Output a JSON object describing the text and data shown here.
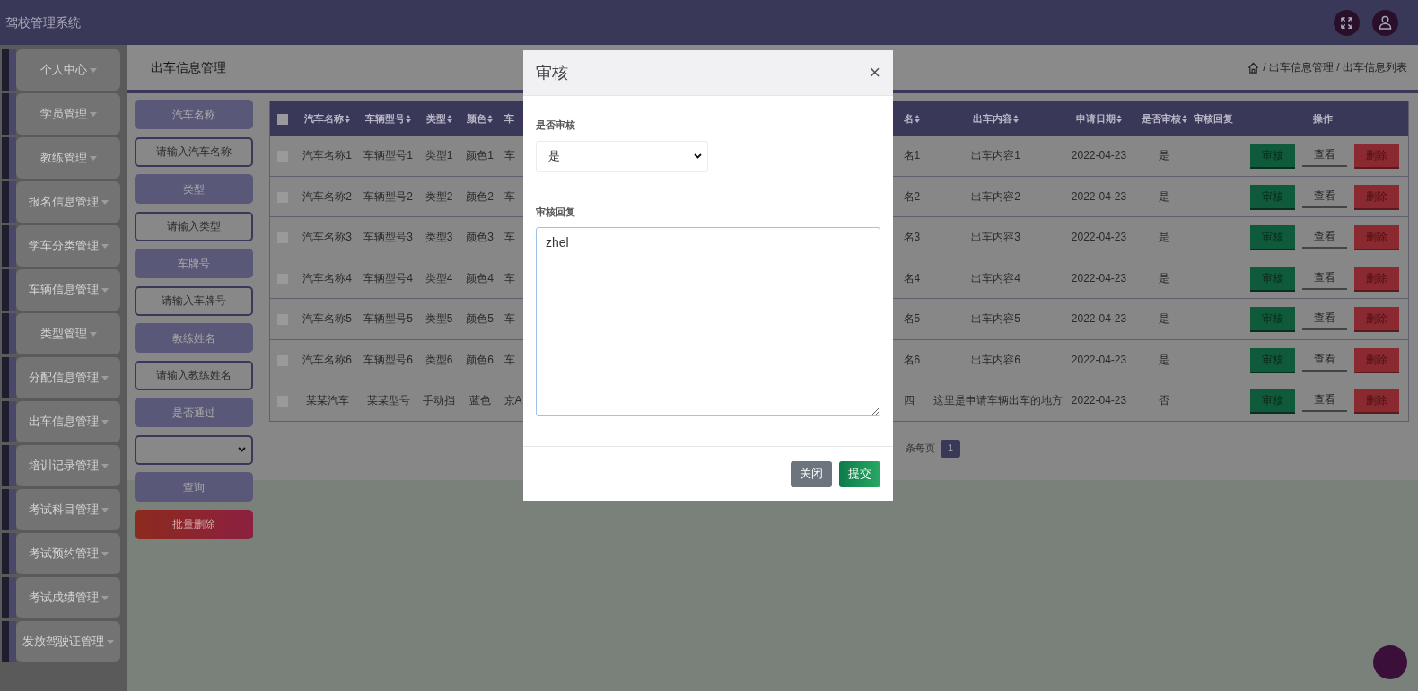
{
  "topbar": {
    "title": "驾校管理系统"
  },
  "sidebar": {
    "items": [
      {
        "label": "个人中心"
      },
      {
        "label": "学员管理"
      },
      {
        "label": "教练管理"
      },
      {
        "label": "报名信息管理"
      },
      {
        "label": "学车分类管理"
      },
      {
        "label": "车辆信息管理"
      },
      {
        "label": "类型管理"
      },
      {
        "label": "分配信息管理"
      },
      {
        "label": "出车信息管理"
      },
      {
        "label": "培训记录管理"
      },
      {
        "label": "考试科目管理"
      },
      {
        "label": "考试预约管理"
      },
      {
        "label": "考试成绩管理"
      },
      {
        "label": "发放驾驶证管理"
      }
    ]
  },
  "header": {
    "title": "出车信息管理",
    "breadcrumb": "/ 出车信息管理 / 出车信息列表"
  },
  "filters": [
    {
      "kind": "label",
      "text": "汽车名称"
    },
    {
      "kind": "input",
      "placeholder": "请输入汽车名称"
    },
    {
      "kind": "label",
      "text": "类型"
    },
    {
      "kind": "input",
      "placeholder": "请输入类型"
    },
    {
      "kind": "label",
      "text": "车牌号"
    },
    {
      "kind": "input",
      "placeholder": "请输入车牌号"
    },
    {
      "kind": "label",
      "text": "教练姓名"
    },
    {
      "kind": "input",
      "placeholder": "请输入教练姓名"
    },
    {
      "kind": "label",
      "text": "是否通过"
    },
    {
      "kind": "select"
    },
    {
      "kind": "search",
      "text": "查询"
    },
    {
      "kind": "danger",
      "text": "批量删除"
    }
  ],
  "table": {
    "all_checked": false,
    "columns": [
      {
        "label": "汽车名称",
        "sortable": true
      },
      {
        "label": "车辆型号",
        "sortable": true
      },
      {
        "label": "类型",
        "sortable": true
      },
      {
        "label": "颜色",
        "sortable": true
      },
      {
        "label": "车",
        "sortable": false
      },
      {
        "label": "名",
        "sortable": true
      },
      {
        "label": "出车内容",
        "sortable": true
      },
      {
        "label": "申请日期",
        "sortable": true
      },
      {
        "label": "是否审核",
        "sortable": true
      },
      {
        "label": "审核回复",
        "sortable": false
      },
      {
        "label": "操作",
        "sortable": false
      }
    ],
    "rows": [
      {
        "checked": false,
        "cells": [
          "汽车名称1",
          "车辆型号1",
          "类型1",
          "颜色1",
          "车",
          "名1",
          "出车内容1",
          "2022-04-23",
          "是"
        ],
        "actions": [
          {
            "kind": "audit",
            "label": "审核"
          },
          {
            "kind": "view",
            "label": "查看"
          },
          {
            "kind": "delete",
            "label": "删除"
          }
        ]
      },
      {
        "checked": false,
        "cells": [
          "汽车名称2",
          "车辆型号2",
          "类型2",
          "颜色2",
          "车",
          "名2",
          "出车内容2",
          "2022-04-23",
          "是"
        ],
        "actions": [
          {
            "kind": "audit",
            "label": "审核"
          },
          {
            "kind": "view",
            "label": "查看"
          },
          {
            "kind": "delete",
            "label": "删除"
          }
        ]
      },
      {
        "checked": false,
        "cells": [
          "汽车名称3",
          "车辆型号3",
          "类型3",
          "颜色3",
          "车",
          "名3",
          "出车内容3",
          "2022-04-23",
          "是"
        ],
        "actions": [
          {
            "kind": "audit",
            "label": "审核"
          },
          {
            "kind": "view",
            "label": "查看"
          },
          {
            "kind": "delete",
            "label": "删除"
          }
        ]
      },
      {
        "checked": false,
        "cells": [
          "汽车名称4",
          "车辆型号4",
          "类型4",
          "颜色4",
          "车",
          "名4",
          "出车内容4",
          "2022-04-23",
          "是"
        ],
        "actions": [
          {
            "kind": "audit",
            "label": "审核"
          },
          {
            "kind": "view",
            "label": "查看"
          },
          {
            "kind": "delete",
            "label": "删除"
          }
        ]
      },
      {
        "checked": false,
        "cells": [
          "汽车名称5",
          "车辆型号5",
          "类型5",
          "颜色5",
          "车",
          "名5",
          "出车内容5",
          "2022-04-23",
          "是"
        ],
        "actions": [
          {
            "kind": "audit",
            "label": "审核"
          },
          {
            "kind": "view",
            "label": "查看"
          },
          {
            "kind": "delete",
            "label": "删除"
          }
        ]
      },
      {
        "checked": false,
        "cells": [
          "汽车名称6",
          "车辆型号6",
          "类型6",
          "颜色6",
          "车",
          "名6",
          "出车内容6",
          "2022-04-23",
          "是"
        ],
        "actions": [
          {
            "kind": "audit",
            "label": "审核"
          },
          {
            "kind": "view",
            "label": "查看"
          },
          {
            "kind": "delete",
            "label": "删除"
          }
        ]
      },
      {
        "checked": false,
        "cells": [
          "某某汽车",
          "某某型号",
          "手动挡",
          "蓝色",
          "京A",
          "四",
          "这里是申请车辆出车的地方",
          "2022-04-23",
          "否"
        ],
        "actions": [
          {
            "kind": "audit",
            "label": "审核"
          },
          {
            "kind": "view",
            "label": "查看"
          },
          {
            "kind": "delete",
            "label": "删除"
          }
        ]
      }
    ]
  },
  "pagination": {
    "per_page_label": "条每页",
    "pages": [
      {
        "label": "1",
        "selected": true
      }
    ]
  },
  "modal": {
    "title": "审核",
    "close": "×",
    "fields": [
      {
        "kind": "select",
        "label": "是否审核",
        "value": "是"
      },
      {
        "kind": "textarea",
        "label": "审核回复",
        "value": "zhel"
      }
    ],
    "buttons": [
      {
        "kind": "secondary",
        "label": "关闭"
      },
      {
        "kind": "primary",
        "label": "提交"
      }
    ]
  }
}
